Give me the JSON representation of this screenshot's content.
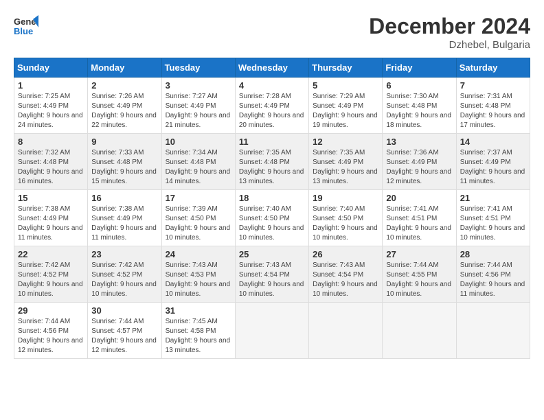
{
  "header": {
    "logo_line1": "General",
    "logo_line2": "Blue",
    "month_title": "December 2024",
    "location": "Dzhebel, Bulgaria"
  },
  "weekdays": [
    "Sunday",
    "Monday",
    "Tuesday",
    "Wednesday",
    "Thursday",
    "Friday",
    "Saturday"
  ],
  "weeks": [
    [
      {
        "day": "1",
        "sunrise": "Sunrise: 7:25 AM",
        "sunset": "Sunset: 4:49 PM",
        "daylight": "Daylight: 9 hours and 24 minutes."
      },
      {
        "day": "2",
        "sunrise": "Sunrise: 7:26 AM",
        "sunset": "Sunset: 4:49 PM",
        "daylight": "Daylight: 9 hours and 22 minutes."
      },
      {
        "day": "3",
        "sunrise": "Sunrise: 7:27 AM",
        "sunset": "Sunset: 4:49 PM",
        "daylight": "Daylight: 9 hours and 21 minutes."
      },
      {
        "day": "4",
        "sunrise": "Sunrise: 7:28 AM",
        "sunset": "Sunset: 4:49 PM",
        "daylight": "Daylight: 9 hours and 20 minutes."
      },
      {
        "day": "5",
        "sunrise": "Sunrise: 7:29 AM",
        "sunset": "Sunset: 4:49 PM",
        "daylight": "Daylight: 9 hours and 19 minutes."
      },
      {
        "day": "6",
        "sunrise": "Sunrise: 7:30 AM",
        "sunset": "Sunset: 4:48 PM",
        "daylight": "Daylight: 9 hours and 18 minutes."
      },
      {
        "day": "7",
        "sunrise": "Sunrise: 7:31 AM",
        "sunset": "Sunset: 4:48 PM",
        "daylight": "Daylight: 9 hours and 17 minutes."
      }
    ],
    [
      {
        "day": "8",
        "sunrise": "Sunrise: 7:32 AM",
        "sunset": "Sunset: 4:48 PM",
        "daylight": "Daylight: 9 hours and 16 minutes."
      },
      {
        "day": "9",
        "sunrise": "Sunrise: 7:33 AM",
        "sunset": "Sunset: 4:48 PM",
        "daylight": "Daylight: 9 hours and 15 minutes."
      },
      {
        "day": "10",
        "sunrise": "Sunrise: 7:34 AM",
        "sunset": "Sunset: 4:48 PM",
        "daylight": "Daylight: 9 hours and 14 minutes."
      },
      {
        "day": "11",
        "sunrise": "Sunrise: 7:35 AM",
        "sunset": "Sunset: 4:48 PM",
        "daylight": "Daylight: 9 hours and 13 minutes."
      },
      {
        "day": "12",
        "sunrise": "Sunrise: 7:35 AM",
        "sunset": "Sunset: 4:49 PM",
        "daylight": "Daylight: 9 hours and 13 minutes."
      },
      {
        "day": "13",
        "sunrise": "Sunrise: 7:36 AM",
        "sunset": "Sunset: 4:49 PM",
        "daylight": "Daylight: 9 hours and 12 minutes."
      },
      {
        "day": "14",
        "sunrise": "Sunrise: 7:37 AM",
        "sunset": "Sunset: 4:49 PM",
        "daylight": "Daylight: 9 hours and 11 minutes."
      }
    ],
    [
      {
        "day": "15",
        "sunrise": "Sunrise: 7:38 AM",
        "sunset": "Sunset: 4:49 PM",
        "daylight": "Daylight: 9 hours and 11 minutes."
      },
      {
        "day": "16",
        "sunrise": "Sunrise: 7:38 AM",
        "sunset": "Sunset: 4:49 PM",
        "daylight": "Daylight: 9 hours and 11 minutes."
      },
      {
        "day": "17",
        "sunrise": "Sunrise: 7:39 AM",
        "sunset": "Sunset: 4:50 PM",
        "daylight": "Daylight: 9 hours and 10 minutes."
      },
      {
        "day": "18",
        "sunrise": "Sunrise: 7:40 AM",
        "sunset": "Sunset: 4:50 PM",
        "daylight": "Daylight: 9 hours and 10 minutes."
      },
      {
        "day": "19",
        "sunrise": "Sunrise: 7:40 AM",
        "sunset": "Sunset: 4:50 PM",
        "daylight": "Daylight: 9 hours and 10 minutes."
      },
      {
        "day": "20",
        "sunrise": "Sunrise: 7:41 AM",
        "sunset": "Sunset: 4:51 PM",
        "daylight": "Daylight: 9 hours and 10 minutes."
      },
      {
        "day": "21",
        "sunrise": "Sunrise: 7:41 AM",
        "sunset": "Sunset: 4:51 PM",
        "daylight": "Daylight: 9 hours and 10 minutes."
      }
    ],
    [
      {
        "day": "22",
        "sunrise": "Sunrise: 7:42 AM",
        "sunset": "Sunset: 4:52 PM",
        "daylight": "Daylight: 9 hours and 10 minutes."
      },
      {
        "day": "23",
        "sunrise": "Sunrise: 7:42 AM",
        "sunset": "Sunset: 4:52 PM",
        "daylight": "Daylight: 9 hours and 10 minutes."
      },
      {
        "day": "24",
        "sunrise": "Sunrise: 7:43 AM",
        "sunset": "Sunset: 4:53 PM",
        "daylight": "Daylight: 9 hours and 10 minutes."
      },
      {
        "day": "25",
        "sunrise": "Sunrise: 7:43 AM",
        "sunset": "Sunset: 4:54 PM",
        "daylight": "Daylight: 9 hours and 10 minutes."
      },
      {
        "day": "26",
        "sunrise": "Sunrise: 7:43 AM",
        "sunset": "Sunset: 4:54 PM",
        "daylight": "Daylight: 9 hours and 10 minutes."
      },
      {
        "day": "27",
        "sunrise": "Sunrise: 7:44 AM",
        "sunset": "Sunset: 4:55 PM",
        "daylight": "Daylight: 9 hours and 10 minutes."
      },
      {
        "day": "28",
        "sunrise": "Sunrise: 7:44 AM",
        "sunset": "Sunset: 4:56 PM",
        "daylight": "Daylight: 9 hours and 11 minutes."
      }
    ],
    [
      {
        "day": "29",
        "sunrise": "Sunrise: 7:44 AM",
        "sunset": "Sunset: 4:56 PM",
        "daylight": "Daylight: 9 hours and 12 minutes."
      },
      {
        "day": "30",
        "sunrise": "Sunrise: 7:44 AM",
        "sunset": "Sunset: 4:57 PM",
        "daylight": "Daylight: 9 hours and 12 minutes."
      },
      {
        "day": "31",
        "sunrise": "Sunrise: 7:45 AM",
        "sunset": "Sunset: 4:58 PM",
        "daylight": "Daylight: 9 hours and 13 minutes."
      },
      null,
      null,
      null,
      null
    ]
  ]
}
